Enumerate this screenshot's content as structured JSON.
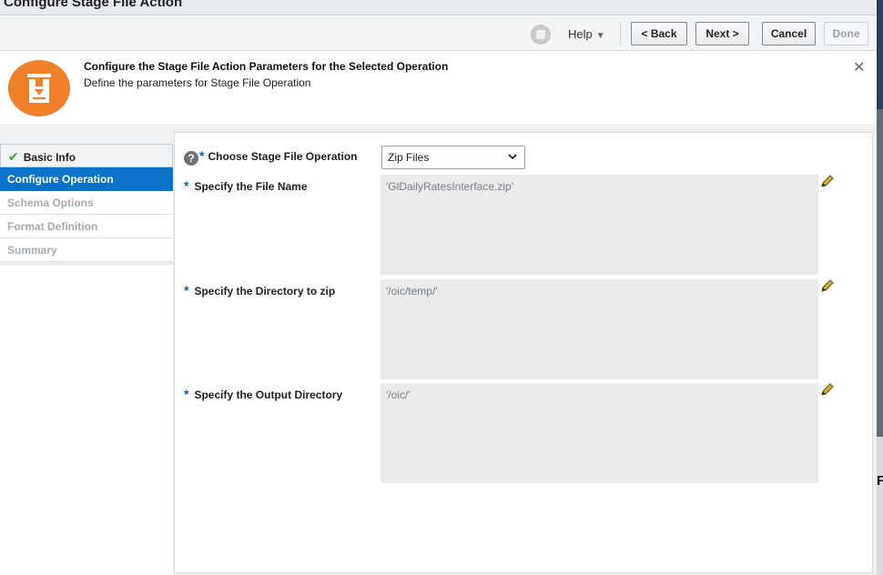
{
  "dialog": {
    "title": "Configure Stage File Action"
  },
  "toolbar": {
    "help_label": "Help",
    "help_caret": "▼",
    "back_label": "<  Back",
    "next_label": "Next  >",
    "cancel_label": "Cancel",
    "done_label": "Done"
  },
  "header": {
    "title": "Configure the Stage File Action Parameters for the Selected Operation",
    "subtitle": "Define the parameters for Stage File Operation",
    "close_glyph": "✕",
    "icon": "stage-file-icon",
    "icon_color": "#f0812a"
  },
  "nav": {
    "items": [
      {
        "label": "Basic Info",
        "state": "done",
        "icon": "check-icon",
        "check_glyph": "✔"
      },
      {
        "label": "Configure Operation",
        "state": "active"
      },
      {
        "label": "Schema Options",
        "state": "disabled"
      },
      {
        "label": "Format Definition",
        "state": "disabled"
      },
      {
        "label": "Summary",
        "state": "disabled"
      }
    ],
    "active_color": "#0a72c7"
  },
  "form": {
    "required_marker": "*",
    "help_glyph": "?",
    "operation": {
      "label": "Choose Stage File Operation",
      "selected": "Zip Files"
    },
    "file_name": {
      "label": "Specify the File Name",
      "value": "'GlDailyRatesInterface.zip'"
    },
    "directory": {
      "label": "Specify the Directory to zip",
      "value": "'/oic/temp/'"
    },
    "output_directory": {
      "label": "Specify the Output Directory",
      "value": "'/oic/'"
    }
  },
  "background_app": {
    "glyph": "F"
  }
}
